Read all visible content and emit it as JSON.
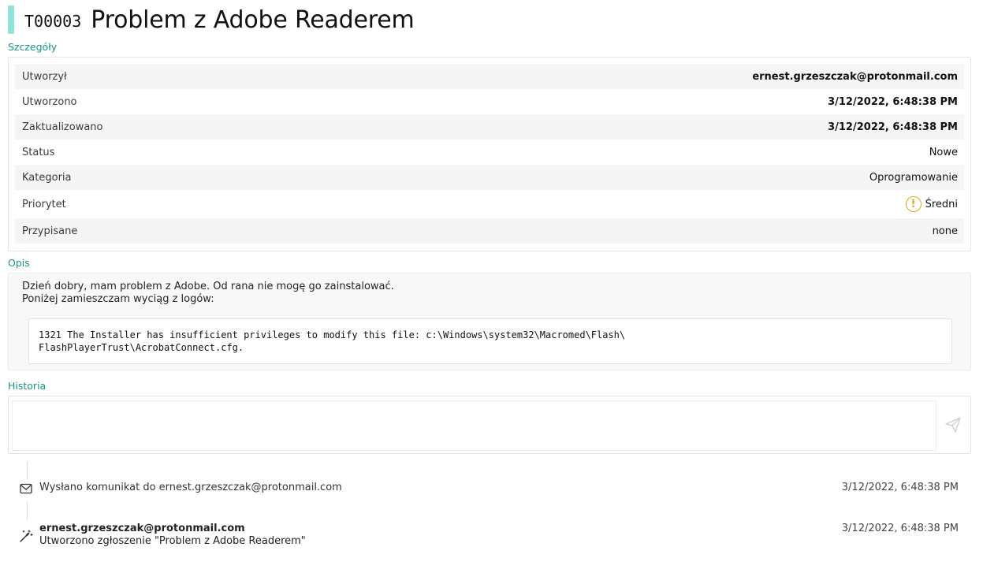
{
  "ticket": {
    "id": "T00003",
    "title": "Problem z Adobe Readerem"
  },
  "sections": {
    "details": "Szczegóły",
    "description": "Opis",
    "history": "Historia"
  },
  "details": [
    {
      "label": "Utworzył",
      "value": "ernest.grzeszczak@protonmail.com"
    },
    {
      "label": "Utworzono",
      "value": "3/12/2022, 6:48:38 PM"
    },
    {
      "label": "Zaktualizowano",
      "value": "3/12/2022, 6:48:38 PM"
    },
    {
      "label": "Status",
      "value": "Nowe"
    },
    {
      "label": "Kategoria",
      "value": "Oprogramowanie"
    },
    {
      "label": "Priorytet",
      "value": "Średni",
      "icon": "warning-icon",
      "icon_glyph": "!",
      "icon_color": "#e8a317"
    },
    {
      "label": "Przypisane",
      "value": "none"
    }
  ],
  "description": {
    "line1": "Dzień dobry, mam problem z Adobe. Od rana nie mogę go zainstalować.",
    "line2": "Poniżej zamieszczam wyciąg z logów:",
    "log": "1321 The Installer has insufficient privileges to modify this file: c:\\Windows\\system32\\Macromed\\Flash\\\nFlashPlayerTrust\\AcrobatConnect.cfg."
  },
  "history": {
    "send_icon": "send-icon",
    "events": [
      {
        "icon": "mail-icon",
        "text": "Wysłano komunikat do ernest.grzeszczak@protonmail.com",
        "time": "3/12/2022, 6:48:38 PM"
      },
      {
        "icon": "magic-wand-icon",
        "author": "ernest.grzeszczak@protonmail.com",
        "text": "Utworzono zgłoszenie \"Problem z Adobe Readerem\"",
        "time": "3/12/2022, 6:48:38 PM"
      }
    ]
  },
  "colors": {
    "accent": "#1a9384",
    "header_bar": "#8ee4d6",
    "warning": "#e8a317"
  }
}
